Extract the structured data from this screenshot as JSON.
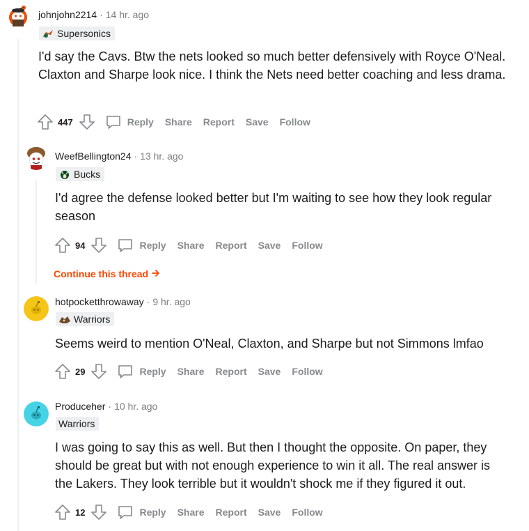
{
  "comments": [
    {
      "author": "johnjohn2214",
      "time": "14 hr. ago",
      "flair": "Supersonics",
      "body": "I'd say the Cavs. Btw the nets looked so much better defensively with Royce O'Neal. Claxton and Sharpe look nice. I think the Nets need better coaching and less drama.",
      "score": "447"
    },
    {
      "author": "WeefBellington24",
      "time": "13 hr. ago",
      "flair": "Bucks",
      "body": "I'd agree the defense looked better but I'm waiting to see how they look regular season",
      "score": "94"
    },
    {
      "author": "hotpocketthrowaway",
      "time": "9 hr. ago",
      "flair": "Warriors",
      "body": "Seems weird to mention O'Neal, Claxton, and Sharpe but not Simmons lmfao",
      "score": "29"
    },
    {
      "author": "Produceher",
      "time": "10 hr. ago",
      "flair": "Warriors",
      "body": "I was going to say this as well. But then I thought the opposite. On paper, they should be great but with not enough experience to win it all. The real answer is the Lakers. They look terrible but it wouldn't shock me if they figured it out.",
      "score": "12"
    }
  ],
  "actions": {
    "reply": "Reply",
    "share": "Share",
    "report": "Report",
    "save": "Save",
    "follow": "Follow"
  },
  "continue_thread": "Continue this thread",
  "separator": "·",
  "colors": {
    "accent": "#ff4500",
    "flair_bg": "#edeff1",
    "meta": "#7c7c7c"
  }
}
